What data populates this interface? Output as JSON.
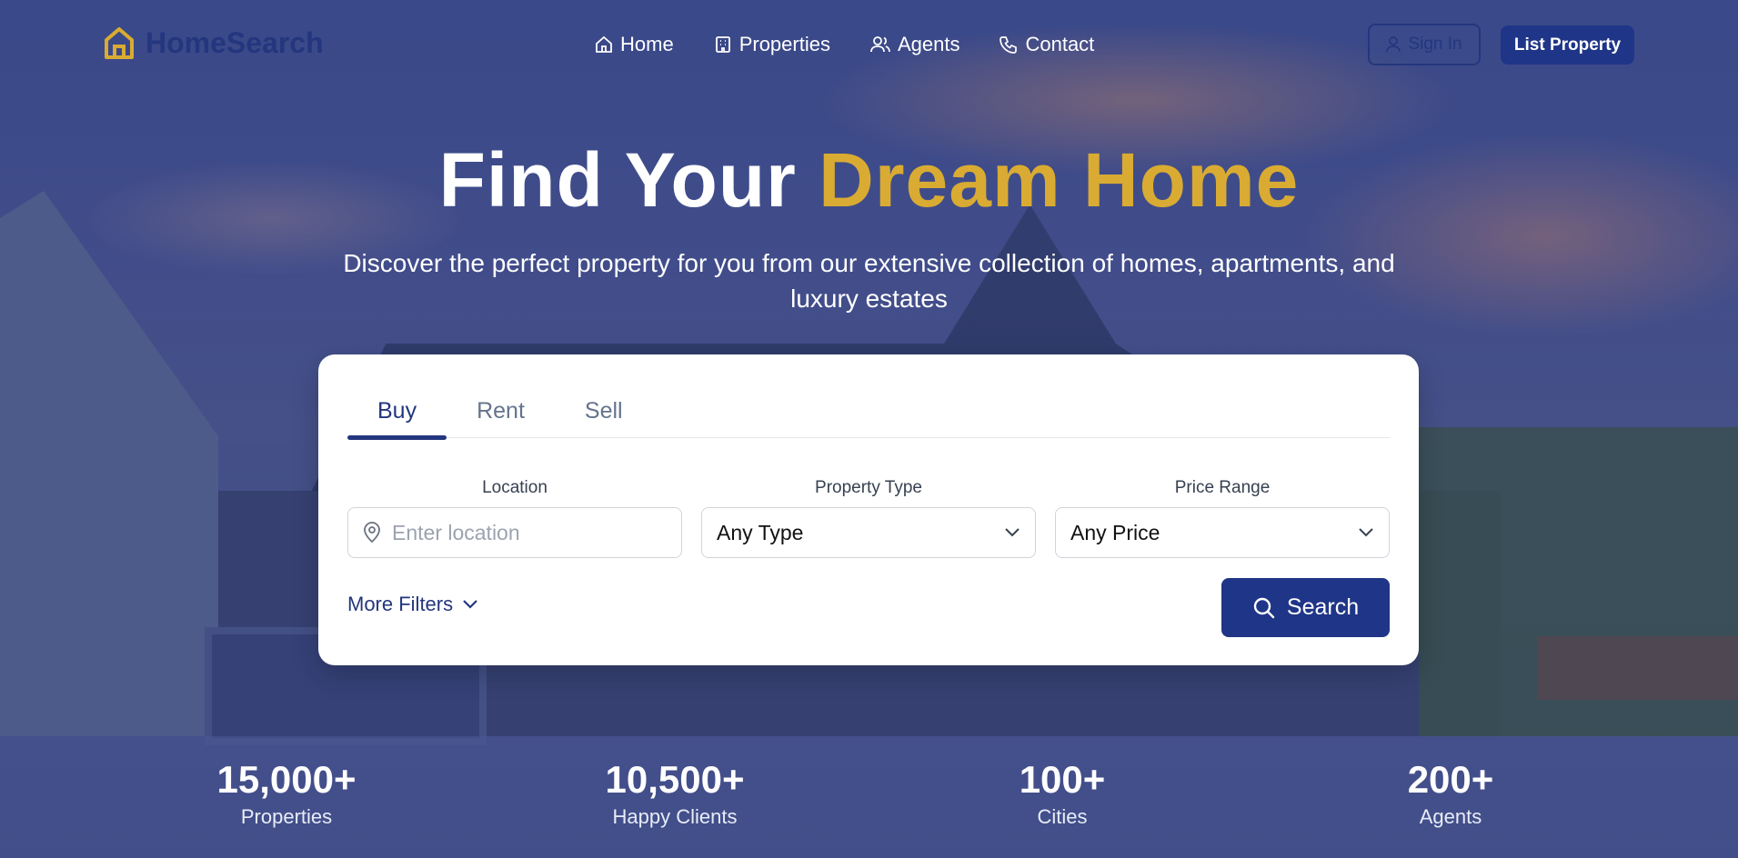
{
  "brand": {
    "name": "HomeSearch",
    "accent": "#d9ab32",
    "primary": "#1f3587"
  },
  "nav": {
    "items": [
      {
        "label": "Home",
        "icon": "home-icon"
      },
      {
        "label": "Properties",
        "icon": "building-icon"
      },
      {
        "label": "Agents",
        "icon": "users-icon"
      },
      {
        "label": "Contact",
        "icon": "phone-icon"
      }
    ],
    "sign_in": "Sign In",
    "list_property": "List Property"
  },
  "hero": {
    "title_part1": "Find Your",
    "title_part2": "Dream Home",
    "subtitle": "Discover the perfect property for you from our extensive collection of homes, apartments, and luxury estates"
  },
  "search": {
    "tabs": [
      "Buy",
      "Rent",
      "Sell"
    ],
    "active_tab": "Buy",
    "location_label": "Location",
    "location_placeholder": "Enter location",
    "type_label": "Property Type",
    "type_value": "Any Type",
    "price_label": "Price Range",
    "price_value": "Any Price",
    "more_filters": "More Filters",
    "search_button": "Search"
  },
  "stats": [
    {
      "value": "15,000+",
      "label": "Properties"
    },
    {
      "value": "10,500+",
      "label": "Happy Clients"
    },
    {
      "value": "100+",
      "label": "Cities"
    },
    {
      "value": "200+",
      "label": "Agents"
    }
  ]
}
